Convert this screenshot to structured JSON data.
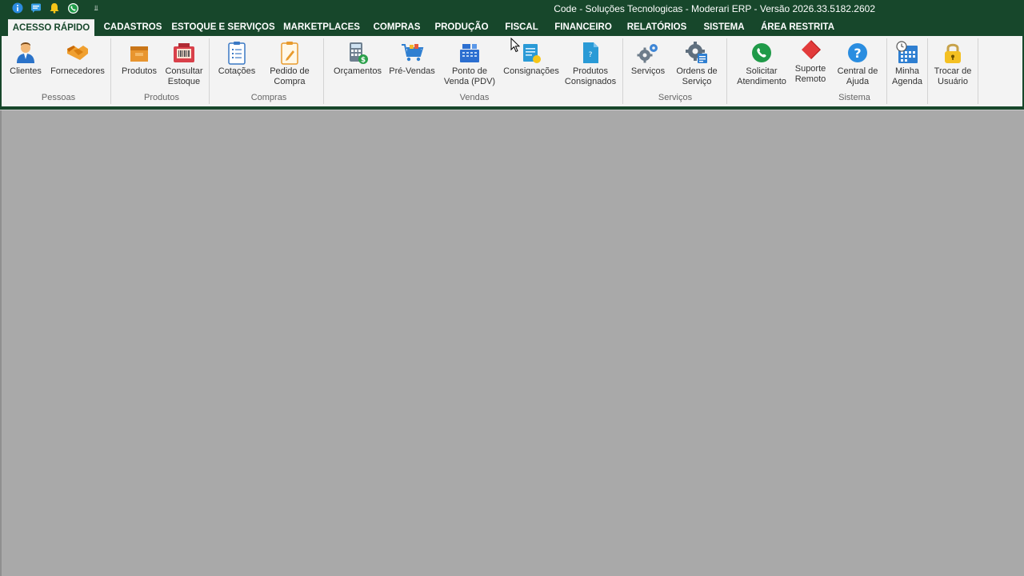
{
  "window": {
    "title": "Code - Soluções Tecnologicas - Moderari ERP - Versão 2026.33.5182.2602"
  },
  "quick_access": [
    {
      "icon": "info-icon"
    },
    {
      "icon": "chat-icon"
    },
    {
      "icon": "bell-icon"
    },
    {
      "icon": "whatsapp-icon"
    },
    {
      "icon": "customize-arrow-icon",
      "text": "⫫"
    }
  ],
  "tabs": [
    {
      "label": "ACESSO RÁPIDO",
      "active": true
    },
    {
      "label": "CADASTROS"
    },
    {
      "label": "ESTOQUE E SERVIÇOS"
    },
    {
      "label": "MARKETPLACES"
    },
    {
      "label": "COMPRAS"
    },
    {
      "label": "PRODUÇÃO"
    },
    {
      "label": "FISCAL"
    },
    {
      "label": "FINANCEIRO"
    },
    {
      "label": "RELATÓRIOS"
    },
    {
      "label": "SISTEMA"
    },
    {
      "label": "ÁREA RESTRITA"
    }
  ],
  "groups": {
    "pessoas": "Pessoas",
    "produtos": "Produtos",
    "compras": "Compras",
    "vendas": "Vendas",
    "servicos": "Serviços",
    "sistema": "Sistema"
  },
  "buttons": {
    "clientes": "Clientes",
    "fornecedores": "Fornecedores",
    "produtos": "Produtos",
    "consultar_estoque": "Consultar\nEstoque",
    "cotacoes": "Cotações",
    "pedido_compra": "Pedido de\nCompra",
    "orcamentos": "Orçamentos",
    "pre_vendas": "Pré-Vendas",
    "pdv": "Ponto de\nVenda (PDV)",
    "consignacoes": "Consignações",
    "produtos_consignados": "Produtos\nConsignados",
    "servicos": "Serviços",
    "ordens_servico": "Ordens de\nServiço",
    "solicitar_atendimento": "Solicitar\nAtendimento",
    "suporte_remoto": "Suporte\nRemoto",
    "central_ajuda": "Central de\nAjuda",
    "minha_agenda": "Minha\nAgenda",
    "trocar_usuario": "Trocar de\nUsuário"
  },
  "colors": {
    "frame": "#17472b",
    "ribbon": "#f3f3f3",
    "workspace": "#a9a9a9"
  }
}
